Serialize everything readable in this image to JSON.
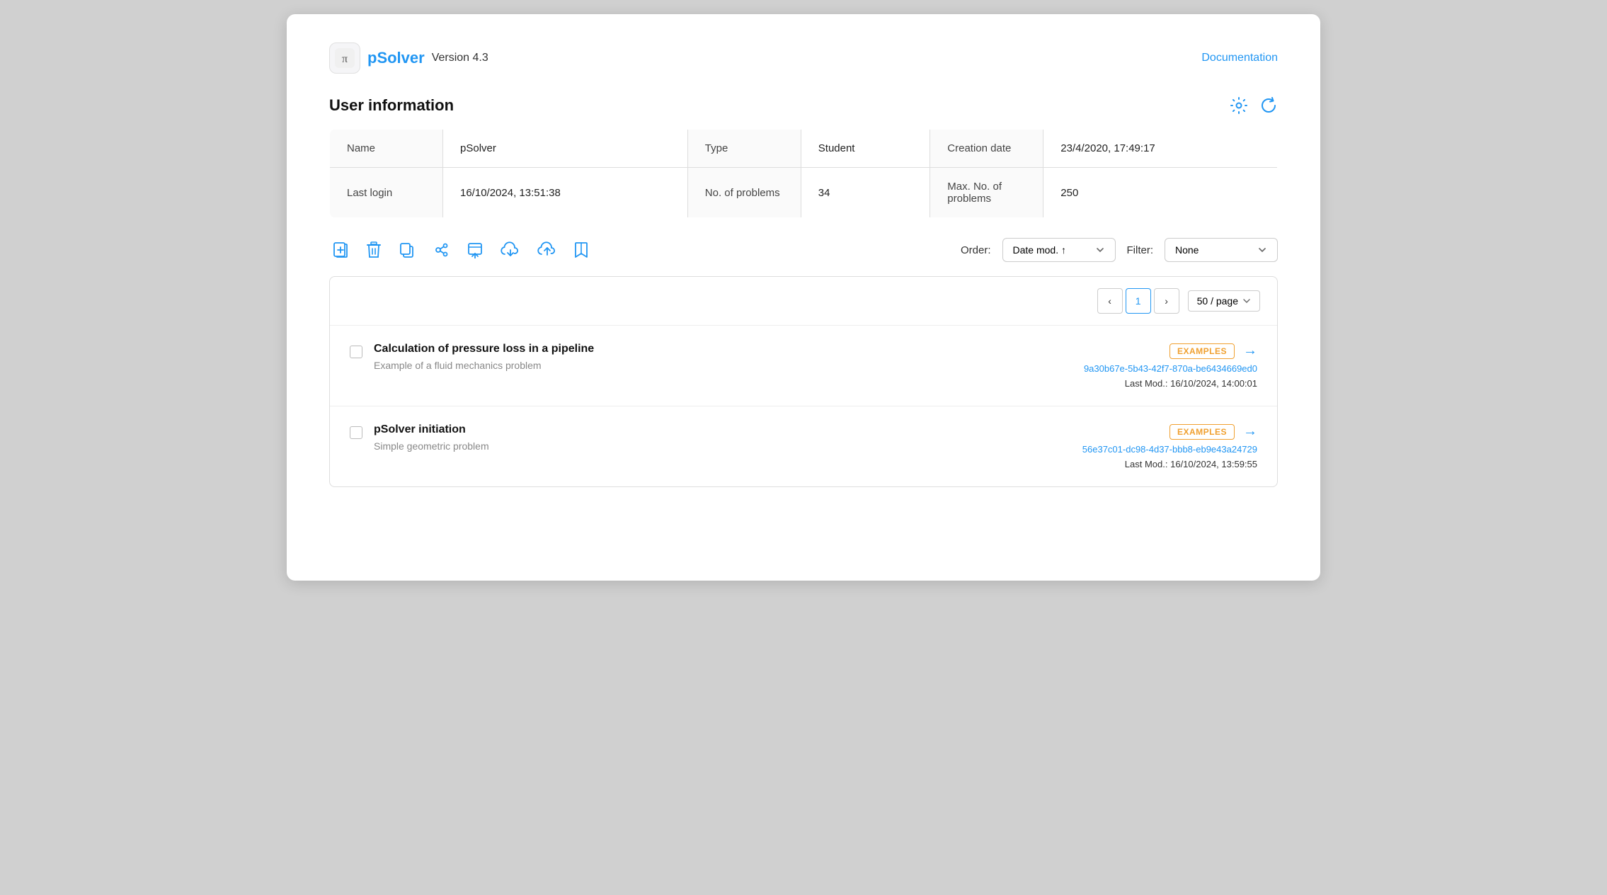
{
  "app": {
    "name": "pSolver",
    "version": "Version 4.3",
    "doc_link": "Documentation"
  },
  "page": {
    "title": "User information",
    "settings_icon": "⚙",
    "refresh_icon": "↻"
  },
  "user_info": {
    "rows": [
      {
        "col1_label": "Name",
        "col1_value": "pSolver",
        "col2_label": "Type",
        "col2_value": "Student",
        "col3_label": "Creation date",
        "col3_value": "23/4/2020, 17:49:17"
      },
      {
        "col1_label": "Last login",
        "col1_value": "16/10/2024, 13:51:38",
        "col2_label": "No. of problems",
        "col2_value": "34",
        "col3_label": "Max. No. of problems",
        "col3_value": "250"
      }
    ]
  },
  "toolbar": {
    "order_label": "Order:",
    "order_value": "Date mod. ↑",
    "filter_label": "Filter:",
    "filter_value": "None"
  },
  "pagination": {
    "current_page": "1",
    "per_page": "50 / page"
  },
  "problems": [
    {
      "title": "Calculation of pressure loss in a pipeline",
      "description": "Example of a fluid mechanics problem",
      "badge": "EXAMPLES",
      "uuid": "9a30b67e-5b43-42f7-870a-be6434669ed0",
      "last_mod": "Last Mod.: 16/10/2024, 14:00:01"
    },
    {
      "title": "pSolver initiation",
      "description": "Simple geometric problem",
      "badge": "EXAMPLES",
      "uuid": "56e37c01-dc98-4d37-bbb8-eb9e43a24729",
      "last_mod": "Last Mod.: 16/10/2024, 13:59:55"
    }
  ]
}
